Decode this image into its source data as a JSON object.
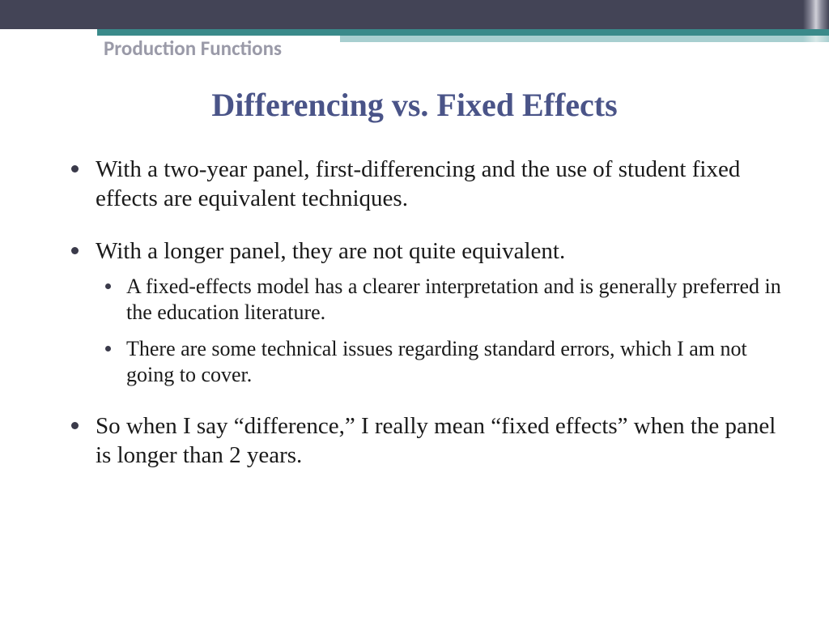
{
  "header": {
    "section_label": "Production Functions",
    "title": "Differencing vs. Fixed Effects"
  },
  "bullets": [
    {
      "text": "With a two-year panel, first-differencing and the use of student fixed effects are equivalent techniques.",
      "sub": []
    },
    {
      "text": "With a longer panel, they are not quite equivalent.",
      "sub": [
        "A fixed-effects model has a clearer interpretation and is generally preferred in the education literature.",
        "There are some technical issues regarding standard errors, which I am not going to cover."
      ]
    },
    {
      "text": "So when I say “difference,” I really mean “fixed effects” when the panel is longer than 2 years.",
      "sub": []
    }
  ]
}
